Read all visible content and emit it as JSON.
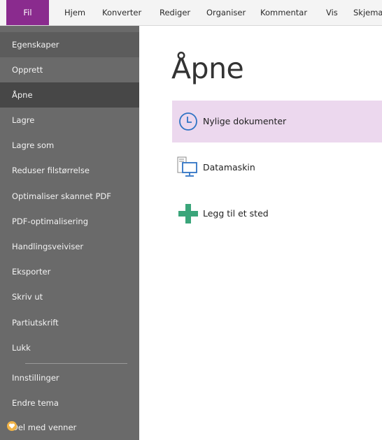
{
  "ribbon": {
    "tabs": [
      {
        "label": "Fil",
        "active": true
      },
      {
        "label": "Hjem"
      },
      {
        "label": "Konverter"
      },
      {
        "label": "Rediger"
      },
      {
        "label": "Organiser"
      },
      {
        "label": "Kommentar"
      },
      {
        "label": "Vis"
      },
      {
        "label": "Skjema"
      }
    ]
  },
  "sidebar": {
    "items": [
      {
        "label": "Egenskaper"
      },
      {
        "label": "Opprett"
      },
      {
        "label": "Åpne",
        "selected": true
      },
      {
        "label": "Lagre"
      },
      {
        "label": "Lagre som"
      },
      {
        "label": "Reduser filstørrelse"
      },
      {
        "label": "Optimaliser skannet PDF"
      },
      {
        "label": "PDF-optimalisering"
      },
      {
        "label": "Handlingsveiviser"
      },
      {
        "label": "Eksporter"
      },
      {
        "label": "Skriv ut"
      },
      {
        "label": "Partiutskrift"
      },
      {
        "label": "Lukk"
      },
      {
        "label": "Innstillinger"
      },
      {
        "label": "Endre tema"
      },
      {
        "label": "Del med venner",
        "icon": "heart-icon"
      }
    ]
  },
  "main": {
    "title": "Åpne",
    "options": [
      {
        "label": "Nylige dokumenter",
        "icon": "clock-icon",
        "active": true
      },
      {
        "label": "Datamaskin",
        "icon": "computer-icon"
      },
      {
        "label": "Legg til et sted",
        "icon": "plus-icon"
      }
    ]
  },
  "colors": {
    "accent": "#8a2b8e",
    "sidebar_bg": "#6a6a6a",
    "sidebar_selected": "#474747",
    "option_highlight": "#ecd8ee",
    "plus_green": "#3aa57a",
    "icon_blue": "#2f73c4"
  }
}
